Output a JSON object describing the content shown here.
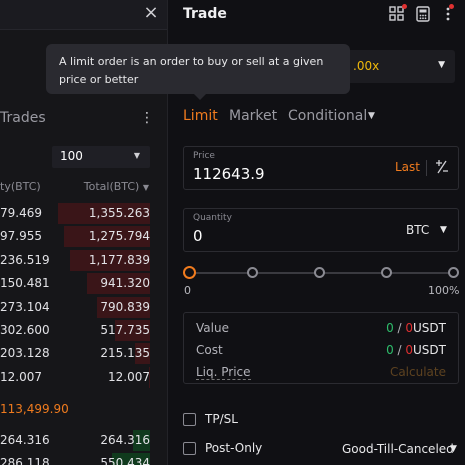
{
  "orderbook": {
    "trades_title": "Trades",
    "depth": "100",
    "col_qty": "ty(BTC)",
    "col_total": "Total(BTC)",
    "asks": [
      {
        "qty": "79.469",
        "total": "1,355.263",
        "depth": 1.0
      },
      {
        "qty": "97.955",
        "total": "1,275.794",
        "depth": 0.94
      },
      {
        "qty": "236.519",
        "total": "1,177.839",
        "depth": 0.87
      },
      {
        "qty": "150.481",
        "total": "941.320",
        "depth": 0.69
      },
      {
        "qty": "273.104",
        "total": "790.839",
        "depth": 0.58
      },
      {
        "qty": "302.600",
        "total": "517.735",
        "depth": 0.38
      },
      {
        "qty": "203.128",
        "total": "215.135",
        "depth": 0.16
      },
      {
        "qty": "12.007",
        "total": "12.007",
        "depth": 0.01
      }
    ],
    "mid_price": "113,499.90",
    "bids": [
      {
        "qty": "264.316",
        "total": "264.316",
        "depth": 0.19
      },
      {
        "qty": "286.118",
        "total": "550.434",
        "depth": 0.41
      }
    ]
  },
  "trade": {
    "title": "Trade",
    "leverage": ".00x",
    "tabs": {
      "limit": "Limit",
      "market": "Market",
      "conditional": "Conditional"
    },
    "price": {
      "label": "Price",
      "value": "112643.9",
      "last": "Last"
    },
    "quantity": {
      "label": "Quantity",
      "value": "0",
      "unit": "BTC"
    },
    "slider": {
      "min_label": "0",
      "max_label": "100%",
      "value": 0
    },
    "summary": {
      "value_label": "Value",
      "cost_label": "Cost",
      "liq_label": "Liq. Price",
      "value_long": "0",
      "value_short": "0",
      "cost_long": "0",
      "cost_short": "0",
      "sep": " / ",
      "unit": "USDT",
      "liq_value": "Calculate"
    },
    "tpsl_label": "TP/SL",
    "post_only_label": "Post-Only",
    "time_in_force": "Good-Till-Canceled"
  },
  "tooltip": {
    "text": "A limit order is an order to buy or sell at a given price or better"
  },
  "colors": {
    "accent": "#f07b1e",
    "buy": "#2ebd6b",
    "sell": "#e03131",
    "leverage": "#f0b90b"
  }
}
